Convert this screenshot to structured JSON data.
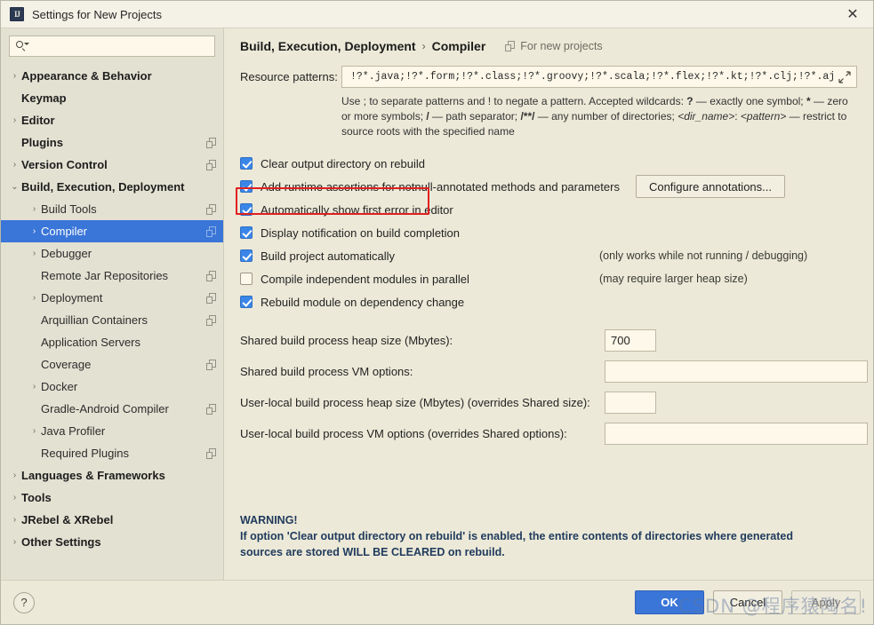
{
  "window": {
    "title": "Settings for New Projects",
    "app_icon": "intellij-idea-icon",
    "close_label": "✕"
  },
  "sidebar": {
    "search": {
      "placeholder": "",
      "value": ""
    },
    "items": [
      {
        "label": "Appearance & Behavior",
        "depth": 1,
        "bold": true,
        "arrow": "›",
        "copy": false,
        "selected": false
      },
      {
        "label": "Keymap",
        "depth": 1,
        "bold": true,
        "arrow": "",
        "copy": false,
        "selected": false
      },
      {
        "label": "Editor",
        "depth": 1,
        "bold": true,
        "arrow": "›",
        "copy": false,
        "selected": false
      },
      {
        "label": "Plugins",
        "depth": 1,
        "bold": true,
        "arrow": "",
        "copy": true,
        "selected": false
      },
      {
        "label": "Version Control",
        "depth": 1,
        "bold": true,
        "arrow": "›",
        "copy": true,
        "selected": false
      },
      {
        "label": "Build, Execution, Deployment",
        "depth": 1,
        "bold": true,
        "arrow": "⌄",
        "copy": false,
        "selected": false
      },
      {
        "label": "Build Tools",
        "depth": 2,
        "bold": false,
        "arrow": "›",
        "copy": true,
        "selected": false
      },
      {
        "label": "Compiler",
        "depth": 2,
        "bold": false,
        "arrow": "›",
        "copy": true,
        "selected": true
      },
      {
        "label": "Debugger",
        "depth": 2,
        "bold": false,
        "arrow": "›",
        "copy": false,
        "selected": false
      },
      {
        "label": "Remote Jar Repositories",
        "depth": 2,
        "bold": false,
        "arrow": "",
        "copy": true,
        "selected": false
      },
      {
        "label": "Deployment",
        "depth": 2,
        "bold": false,
        "arrow": "›",
        "copy": true,
        "selected": false
      },
      {
        "label": "Arquillian Containers",
        "depth": 2,
        "bold": false,
        "arrow": "",
        "copy": true,
        "selected": false
      },
      {
        "label": "Application Servers",
        "depth": 2,
        "bold": false,
        "arrow": "",
        "copy": false,
        "selected": false
      },
      {
        "label": "Coverage",
        "depth": 2,
        "bold": false,
        "arrow": "",
        "copy": true,
        "selected": false
      },
      {
        "label": "Docker",
        "depth": 2,
        "bold": false,
        "arrow": "›",
        "copy": false,
        "selected": false
      },
      {
        "label": "Gradle-Android Compiler",
        "depth": 2,
        "bold": false,
        "arrow": "",
        "copy": true,
        "selected": false
      },
      {
        "label": "Java Profiler",
        "depth": 2,
        "bold": false,
        "arrow": "›",
        "copy": false,
        "selected": false
      },
      {
        "label": "Required Plugins",
        "depth": 2,
        "bold": false,
        "arrow": "",
        "copy": true,
        "selected": false
      },
      {
        "label": "Languages & Frameworks",
        "depth": 1,
        "bold": true,
        "arrow": "›",
        "copy": false,
        "selected": false
      },
      {
        "label": "Tools",
        "depth": 1,
        "bold": true,
        "arrow": "›",
        "copy": false,
        "selected": false
      },
      {
        "label": "JRebel & XRebel",
        "depth": 1,
        "bold": true,
        "arrow": "›",
        "copy": false,
        "selected": false
      },
      {
        "label": "Other Settings",
        "depth": 1,
        "bold": true,
        "arrow": "›",
        "copy": false,
        "selected": false
      }
    ]
  },
  "main": {
    "breadcrumb": {
      "root": "Build, Execution, Deployment",
      "separator": "›",
      "current": "Compiler",
      "scope_label": "For new projects"
    },
    "resource_patterns": {
      "label": "Resource patterns:",
      "value": "!?*.java;!?*.form;!?*.class;!?*.groovy;!?*.scala;!?*.flex;!?*.kt;!?*.clj;!?*.aj",
      "expand_icon": "expand-icon",
      "help_parts": {
        "p1": "Use ; to separate patterns and ! to negate a pattern. Accepted wildcards: ",
        "q1": "?",
        "p2": " — exactly one symbol; ",
        "q2": "*",
        "p3": " — zero or more symbols; ",
        "q3": "/",
        "p4": " — path separator; ",
        "q4": "/**/",
        "p5": " — any number of directories;  ",
        "i1": "<dir_name>",
        "p6": ": ",
        "i2": "<pattern>",
        "p7": " — restrict to source roots with the specified name"
      }
    },
    "checkboxes": [
      {
        "label": "Clear output directory on rebuild",
        "checked": true,
        "note": ""
      },
      {
        "label": "Add runtime assertions for notnull-annotated methods and parameters",
        "checked": true,
        "note": ""
      },
      {
        "label": "Automatically show first error in editor",
        "checked": true,
        "note": ""
      },
      {
        "label": "Display notification on build completion",
        "checked": true,
        "note": ""
      },
      {
        "label": "Build project automatically",
        "checked": true,
        "note": "(only works while not running / debugging)"
      },
      {
        "label": "Compile independent modules in parallel",
        "checked": false,
        "note": "(may require larger heap size)"
      },
      {
        "label": "Rebuild module on dependency change",
        "checked": true,
        "note": ""
      }
    ],
    "configure_annotations_button": "Configure annotations...",
    "fields": [
      {
        "label": "Shared build process heap size (Mbytes):",
        "value": "700",
        "size": "small"
      },
      {
        "label": "Shared build process VM options:",
        "value": "",
        "size": "wide"
      },
      {
        "label": "User-local build process heap size (Mbytes) (overrides Shared size):",
        "value": "",
        "size": "small"
      },
      {
        "label": "User-local build process VM options (overrides Shared options):",
        "value": "",
        "size": "wide"
      }
    ],
    "warning": {
      "title": "WARNING!",
      "line1": "If option 'Clear output directory on rebuild' is enabled, the entire contents of directories where generated",
      "line2": "sources are stored WILL BE CLEARED on rebuild."
    }
  },
  "footer": {
    "help_label": "?",
    "ok_label": "OK",
    "cancel_label": "Cancel",
    "apply_label": "Apply"
  },
  "watermark": {
    "text": "CSDN @程序猿陶名!"
  },
  "colors": {
    "window_bg": "#ece9d8",
    "sidebar_bg": "#e3e1d2",
    "selection_blue": "#3a75d8",
    "field_bg": "#fdf8e9",
    "highlight_red": "#e02020",
    "warning_text": "#1f3a5c"
  }
}
